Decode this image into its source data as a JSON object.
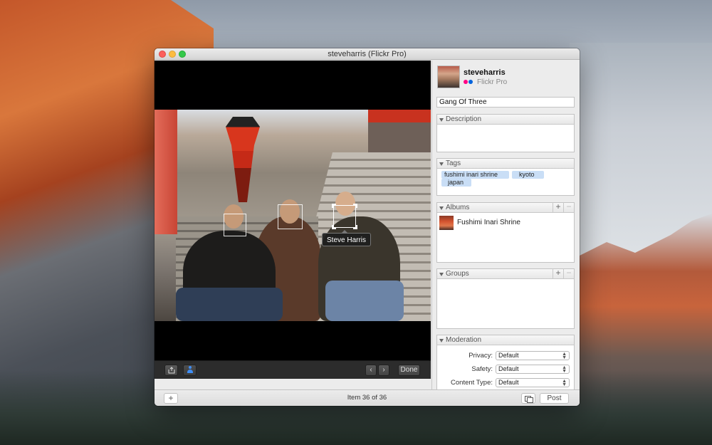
{
  "window": {
    "title": "steveharris (Flickr Pro)"
  },
  "viewer": {
    "face_tag_label": "Steve Harris",
    "done_label": "Done",
    "prev_icon": "‹",
    "next_icon": "›"
  },
  "account": {
    "username": "steveharris",
    "type": "Flickr Pro",
    "dot_colors": [
      "#ff0084",
      "#0063dc"
    ]
  },
  "photo": {
    "title": "Gang Of Three"
  },
  "sections": {
    "description": "Description",
    "tags": "Tags",
    "albums": "Albums",
    "groups": "Groups",
    "moderation": "Moderation"
  },
  "tags": [
    "fushimi inari shrine",
    "kyoto",
    "japan"
  ],
  "albums": [
    {
      "name": "Fushimi Inari Shrine"
    }
  ],
  "moderation": {
    "privacy_label": "Privacy:",
    "privacy_value": "Default",
    "safety_label": "Safety:",
    "safety_value": "Default",
    "content_type_label": "Content Type:",
    "content_type_value": "Default"
  },
  "bottombar": {
    "add_label": "+",
    "item_count": "Item 36 of 36",
    "post_label": "Post"
  },
  "icons": {
    "add": "+",
    "remove": "−"
  }
}
